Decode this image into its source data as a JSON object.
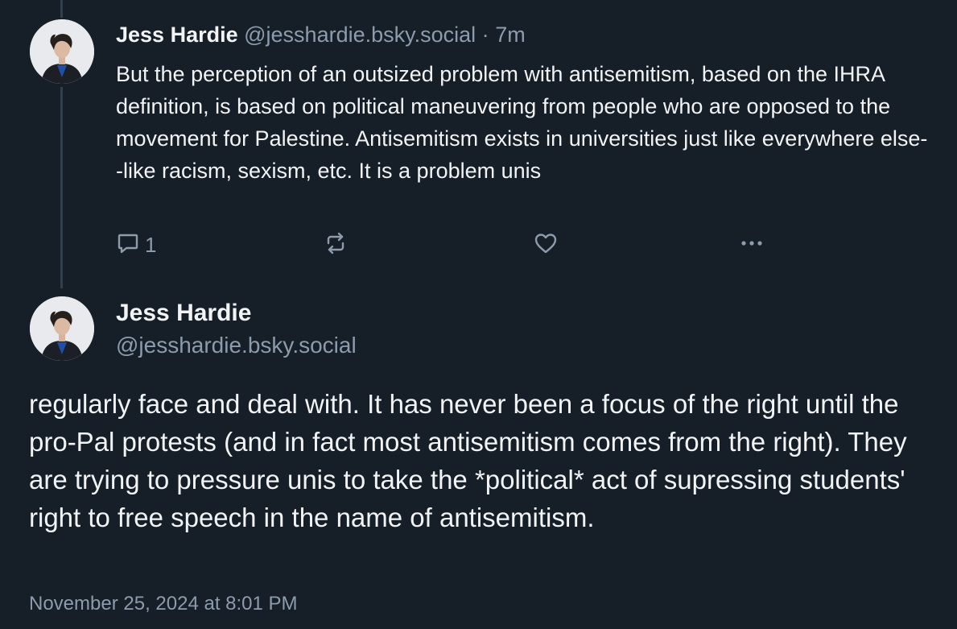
{
  "colors": {
    "background": "#161e27",
    "text": "#f1f3f5",
    "muted": "#8d9cad",
    "thread_line": "#2e4052"
  },
  "post1": {
    "author_name": "Jess Hardie",
    "handle": "@jesshardie.bsky.social",
    "separator": "·",
    "relative_time": "7m",
    "text": "But the perception of an outsized problem with antisemitism, based on the IHRA definition, is based on political maneuvering from people who are opposed to the movement for Palestine. Antisemitism exists in universities just like everywhere else--like racism, sexism, etc. It is a problem unis",
    "actions": {
      "reply_icon": "reply-icon",
      "reply_count": "1",
      "repost_icon": "repost-icon",
      "like_icon": "heart-icon",
      "more_icon": "more-options-icon"
    }
  },
  "post2": {
    "author_name": "Jess Hardie",
    "handle": "@jesshardie.bsky.social",
    "text": "regularly face and deal with. It has never been a focus of the right until the pro-Pal protests (and in fact most antisemitism comes from the right). They are trying to pressure unis to take the *political* act of supressing students' right to free speech in the name of antisemitism.",
    "timestamp": "November 25, 2024 at 8:01 PM"
  }
}
